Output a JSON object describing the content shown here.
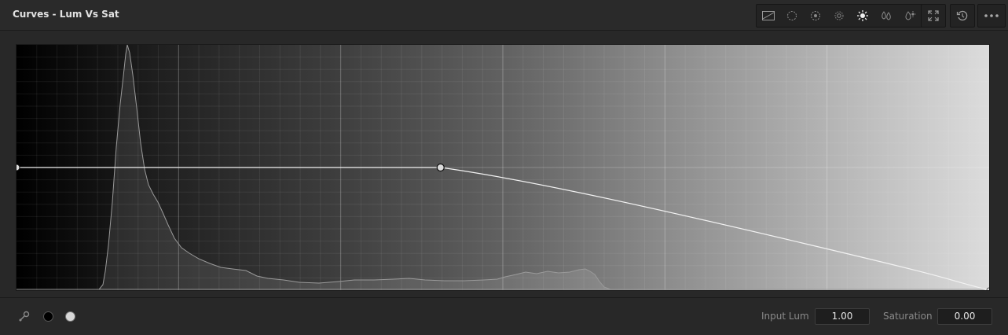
{
  "header": {
    "title": "Curves - Lum Vs Sat"
  },
  "toolbar": {
    "icons": [
      "curve-preview-icon",
      "hue-vs-hue-icon",
      "hue-vs-sat-icon",
      "hue-vs-lum-icon",
      "lum-vs-sat-icon",
      "sat-vs-sat-icon",
      "sat-vs-lum-icon"
    ],
    "selected_icon": "lum-vs-sat-icon",
    "extra_buttons": [
      "expand-icon",
      "reset-icon",
      "more-options-icon"
    ]
  },
  "graph": {
    "control_points": [
      {
        "input_lum": 0.0,
        "saturation": 1.0
      },
      {
        "input_lum": 0.436,
        "saturation": 1.0
      },
      {
        "input_lum": 1.0,
        "saturation": 0.0
      }
    ]
  },
  "footer": {
    "input_lum_label": "Input Lum",
    "input_lum_value": "1.00",
    "saturation_label": "Saturation",
    "saturation_value": "0.00"
  },
  "colors": {
    "panel_bg": "#282828",
    "curve": "#f2f2f2",
    "histogram_stroke": "#9a9a9a"
  }
}
